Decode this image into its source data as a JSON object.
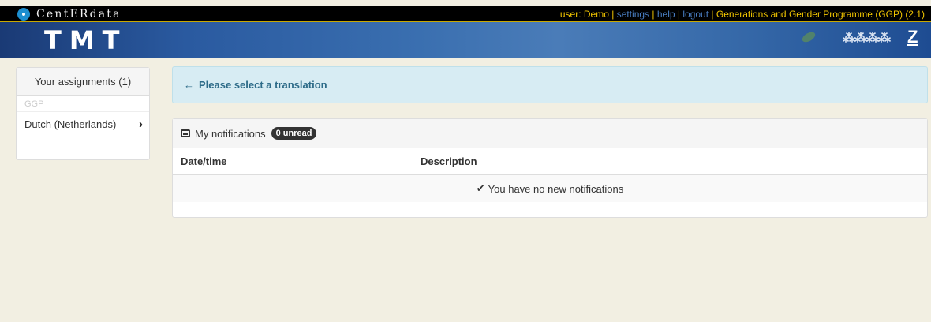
{
  "header": {
    "brand": "CentERdata",
    "user_prefix": "user: Demo",
    "sep": "|",
    "links": [
      "settings",
      "help",
      "logout"
    ],
    "project": "Generations and Gender Programme (GGP) (2.1)",
    "logo_text": "TMT"
  },
  "sidebar": {
    "title": "Your assignments (1)",
    "group": "GGP",
    "items": [
      {
        "label": "Dutch (Netherlands)"
      }
    ]
  },
  "alert": {
    "text": "Please select a translation"
  },
  "notifications": {
    "title": "My notifications",
    "badge": "0 unread",
    "columns": [
      "Date/time",
      "Description"
    ],
    "empty_text": "You have no new notifications"
  },
  "colors": {
    "accent_yellow": "#f2c600",
    "link_blue": "#4a7fc4",
    "banner_blue": "#2a5aa0",
    "alert_bg": "#d7ecf3",
    "page_bg": "#f2efe2"
  }
}
